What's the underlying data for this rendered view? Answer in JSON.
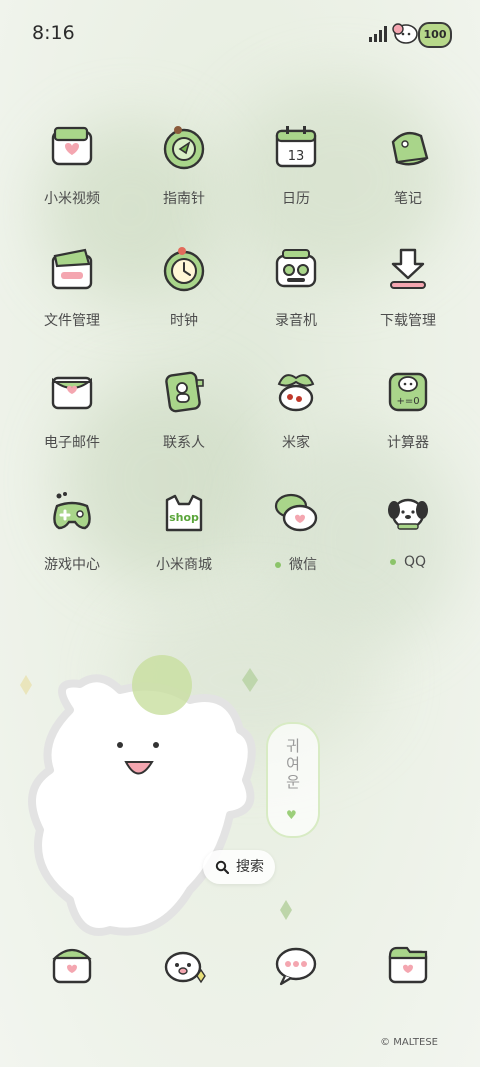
{
  "status": {
    "time": "8:16",
    "battery": "100"
  },
  "apps": [
    {
      "label": "小米视频",
      "icon": "video-icon"
    },
    {
      "label": "指南针",
      "icon": "compass-icon"
    },
    {
      "label": "日历",
      "icon": "calendar-icon",
      "badge": "13"
    },
    {
      "label": "笔记",
      "icon": "notes-icon"
    },
    {
      "label": "文件管理",
      "icon": "folder-icon"
    },
    {
      "label": "时钟",
      "icon": "clock-icon"
    },
    {
      "label": "录音机",
      "icon": "recorder-icon"
    },
    {
      "label": "下载管理",
      "icon": "download-icon"
    },
    {
      "label": "电子邮件",
      "icon": "mail-icon"
    },
    {
      "label": "联系人",
      "icon": "contacts-icon"
    },
    {
      "label": "米家",
      "icon": "home-icon"
    },
    {
      "label": "计算器",
      "icon": "calculator-icon"
    },
    {
      "label": "游戏中心",
      "icon": "gamepad-icon"
    },
    {
      "label": "小米商城",
      "icon": "shop-icon",
      "badge": "shop"
    },
    {
      "label": "微信",
      "icon": "wechat-icon",
      "dot": true
    },
    {
      "label": "QQ",
      "icon": "qq-icon",
      "dot": true
    }
  ],
  "widget": {
    "pill_text": "귀여운",
    "search_label": "搜索"
  },
  "dock": [
    {
      "icon": "phone-icon"
    },
    {
      "icon": "camera-icon"
    },
    {
      "icon": "messages-icon"
    },
    {
      "icon": "gallery-icon"
    }
  ],
  "copyright": "© MALTESE",
  "colors": {
    "accent": "#9ccf7a",
    "pink": "#f4a6b0",
    "outline": "#3a3a3a"
  }
}
